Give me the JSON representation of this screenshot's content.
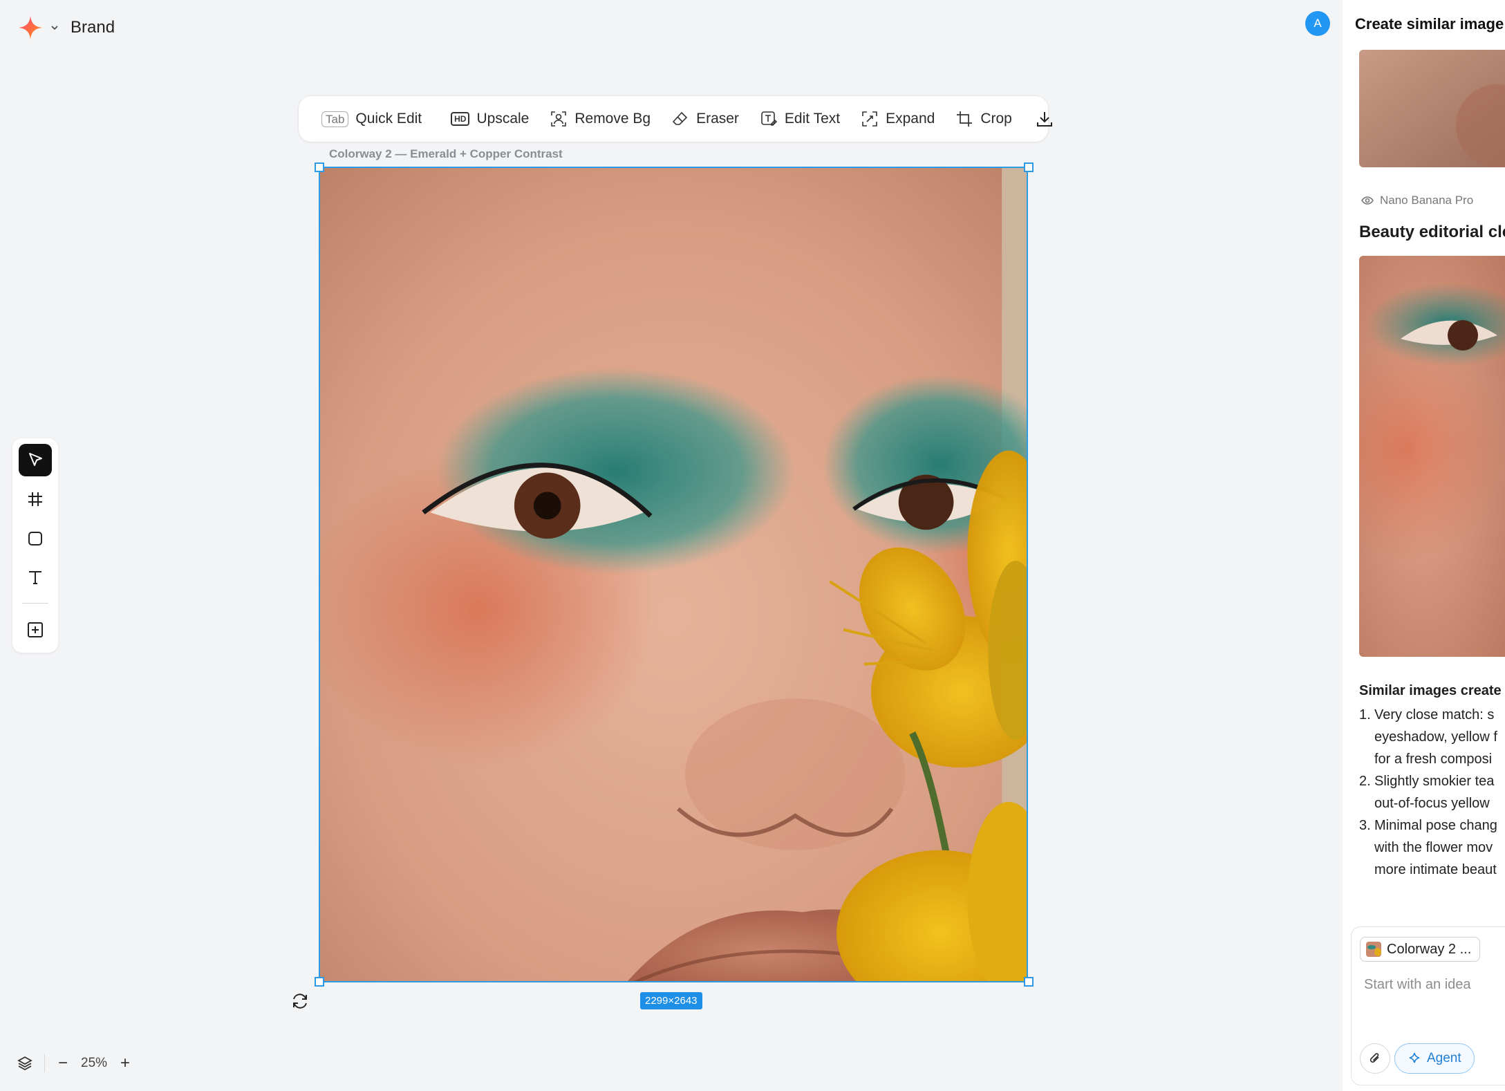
{
  "brand": {
    "name": "Brand",
    "logo_icon": "sparkle-star-icon"
  },
  "toolbar": {
    "quick_edit_key": "Tab",
    "quick_edit": "Quick Edit",
    "upscale_key": "HD",
    "upscale": "Upscale",
    "remove_bg": "Remove Bg",
    "eraser": "Eraser",
    "edit_text": "Edit Text",
    "expand": "Expand",
    "crop": "Crop"
  },
  "canvas": {
    "frame_label": "Colorway 2 — Emerald + Copper Contrast",
    "dimensions": "2299×2643",
    "selection_color": "#2d9ae6"
  },
  "zoom": {
    "level": "25%",
    "minus": "−",
    "plus": "+"
  },
  "user": {
    "avatar_initial": "A",
    "avatar_color": "#2196f3"
  },
  "panel": {
    "title": "Create similar image",
    "model": "Nano Banana Pro",
    "card_title": "Beauty editorial clo",
    "similar_title": "Similar images create",
    "similar_items": [
      {
        "num": "1.",
        "lines": [
          "Very close match: s",
          "eyeshadow, yellow f",
          "for a fresh composi"
        ]
      },
      {
        "num": "2.",
        "lines": [
          "Slightly smokier tea",
          "out-of-focus yellow"
        ]
      },
      {
        "num": "3.",
        "lines": [
          "Minimal pose chang",
          "with the flower mov",
          "more intimate beaut"
        ]
      }
    ],
    "composer": {
      "chip_label": "Colorway 2 ...",
      "placeholder": "Start with an idea",
      "agent_label": "Agent"
    }
  }
}
